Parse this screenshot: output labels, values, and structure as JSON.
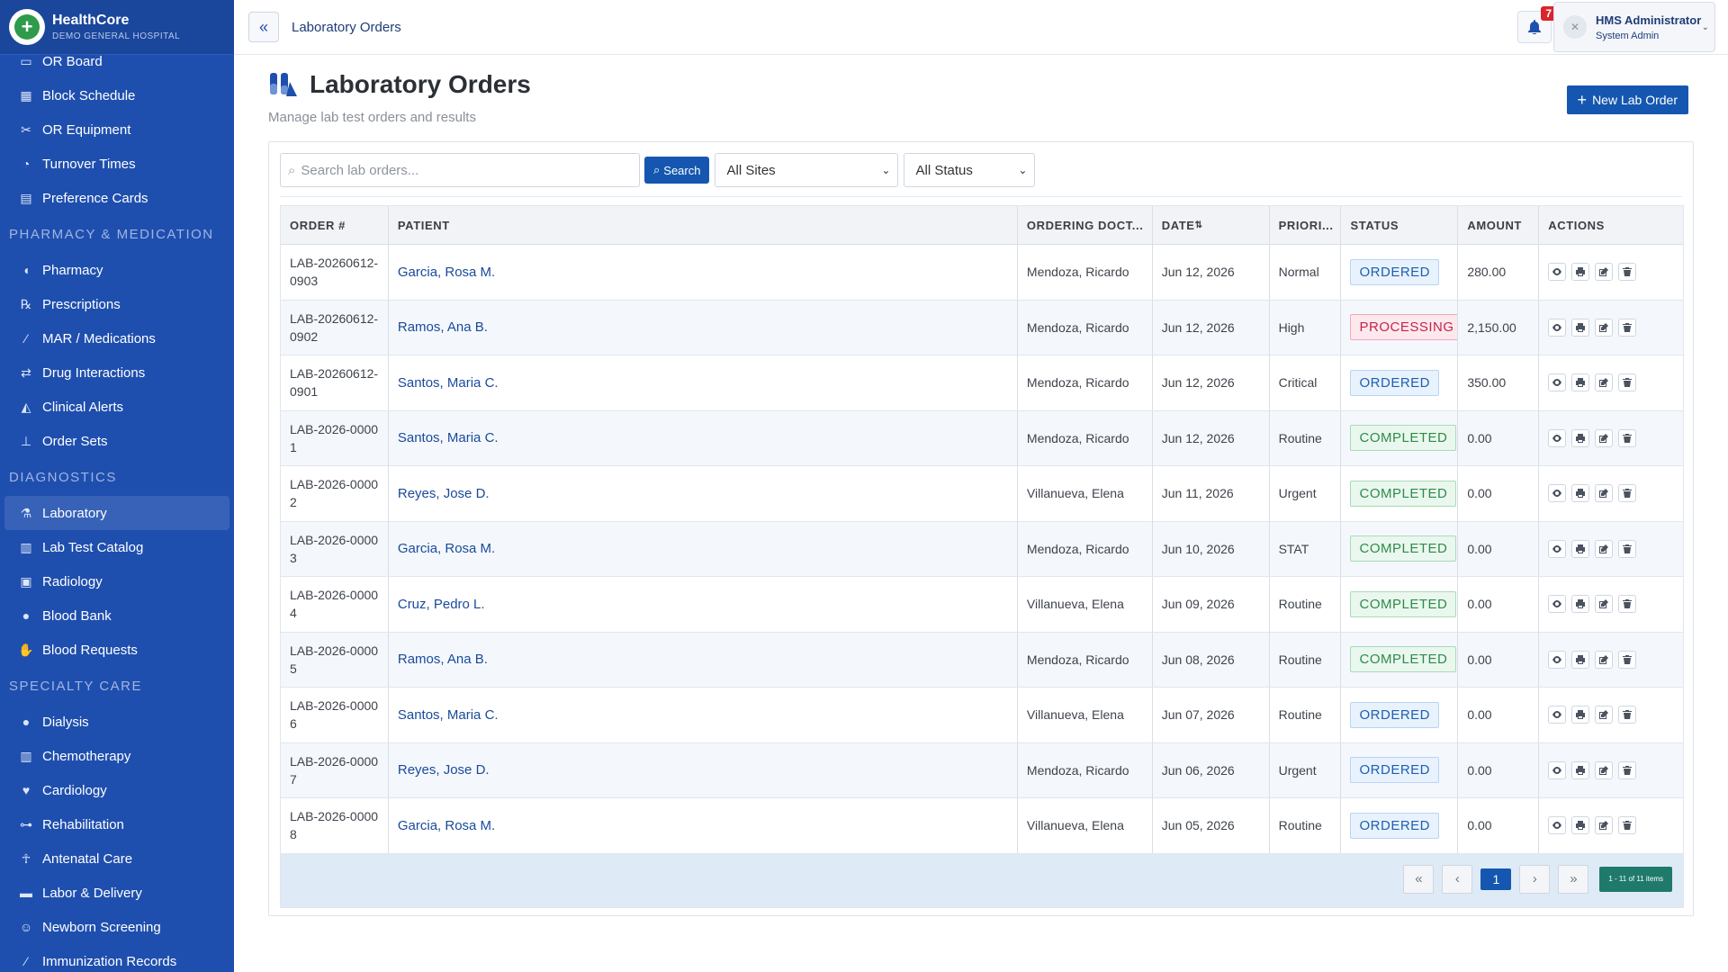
{
  "brand": {
    "name": "HealthCore",
    "sub": "DEMO GENERAL HOSPITAL"
  },
  "sidebar": {
    "items": [
      {
        "label": "OR Board",
        "icon": "monitor-icon"
      },
      {
        "label": "Block Schedule",
        "icon": "calendar-icon"
      },
      {
        "label": "OR Equipment",
        "icon": "tools-icon"
      },
      {
        "label": "Turnover Times",
        "icon": "stopwatch-icon"
      },
      {
        "label": "Preference Cards",
        "icon": "card-list-icon"
      }
    ],
    "section_pharmacy": "PHARMACY & MEDICATION",
    "pharmacy_items": [
      {
        "label": "Pharmacy",
        "icon": "pills-icon"
      },
      {
        "label": "Prescriptions",
        "icon": "prescription-icon"
      },
      {
        "label": "MAR / Medications",
        "icon": "syringe-icon"
      },
      {
        "label": "Drug Interactions",
        "icon": "arrows-exchange-icon"
      },
      {
        "label": "Clinical Alerts",
        "icon": "bell-icon"
      },
      {
        "label": "Order Sets",
        "icon": "sitemap-icon"
      }
    ],
    "section_diagnostics": "DIAGNOSTICS",
    "diagnostics_items": [
      {
        "label": "Laboratory",
        "icon": "flask-icon"
      },
      {
        "label": "Lab Test Catalog",
        "icon": "vials-icon"
      },
      {
        "label": "Radiology",
        "icon": "xray-icon"
      },
      {
        "label": "Blood Bank",
        "icon": "droplet-icon"
      },
      {
        "label": "Blood Requests",
        "icon": "hand-droplet-icon"
      }
    ],
    "section_specialty": "SPECIALTY CARE",
    "specialty_items": [
      {
        "label": "Dialysis",
        "icon": "droplet-icon"
      },
      {
        "label": "Chemotherapy",
        "icon": "vials-icon"
      },
      {
        "label": "Cardiology",
        "icon": "heart-pulse-icon"
      },
      {
        "label": "Rehabilitation",
        "icon": "dumbbell-icon"
      },
      {
        "label": "Antenatal Care",
        "icon": "person-icon"
      },
      {
        "label": "Labor & Delivery",
        "icon": "bed-icon"
      },
      {
        "label": "Newborn Screening",
        "icon": "baby-icon"
      },
      {
        "label": "Immunization Records",
        "icon": "syringe-icon"
      }
    ]
  },
  "topbar": {
    "breadcrumb": "Laboratory Orders",
    "notification_count": "7",
    "user_name": "HMS Administrator",
    "user_role": "System Admin"
  },
  "page": {
    "title": "Laboratory Orders",
    "subtitle": "Manage lab test orders and results",
    "new_button": "New Lab Order"
  },
  "filters": {
    "search_placeholder": "Search lab orders...",
    "search_button": "Search",
    "site_select": "All Sites",
    "status_select": "All Status"
  },
  "table": {
    "columns": [
      "ORDER #",
      "PATIENT",
      "ORDERING DOCT...",
      "DATE",
      "PRIORI...",
      "STATUS",
      "AMOUNT",
      "ACTIONS"
    ],
    "rows": [
      {
        "order": "LAB-20260612-0903",
        "patient": "Garcia, Rosa M.",
        "doctor": "Mendoza, Ricardo",
        "date": "Jun 12, 2026",
        "priority": "Normal",
        "status": "ORDERED",
        "amount": "280.00"
      },
      {
        "order": "LAB-20260612-0902",
        "patient": "Ramos, Ana B.",
        "doctor": "Mendoza, Ricardo",
        "date": "Jun 12, 2026",
        "priority": "High",
        "status": "PROCESSING",
        "amount": "2,150.00"
      },
      {
        "order": "LAB-20260612-0901",
        "patient": "Santos, Maria C.",
        "doctor": "Mendoza, Ricardo",
        "date": "Jun 12, 2026",
        "priority": "Critical",
        "status": "ORDERED",
        "amount": "350.00"
      },
      {
        "order": "LAB-2026-00001",
        "patient": "Santos, Maria C.",
        "doctor": "Mendoza, Ricardo",
        "date": "Jun 12, 2026",
        "priority": "Routine",
        "status": "COMPLETED",
        "amount": "0.00"
      },
      {
        "order": "LAB-2026-00002",
        "patient": "Reyes, Jose D.",
        "doctor": "Villanueva, Elena",
        "date": "Jun 11, 2026",
        "priority": "Urgent",
        "status": "COMPLETED",
        "amount": "0.00"
      },
      {
        "order": "LAB-2026-00003",
        "patient": "Garcia, Rosa M.",
        "doctor": "Mendoza, Ricardo",
        "date": "Jun 10, 2026",
        "priority": "STAT",
        "status": "COMPLETED",
        "amount": "0.00"
      },
      {
        "order": "LAB-2026-00004",
        "patient": "Cruz, Pedro L.",
        "doctor": "Villanueva, Elena",
        "date": "Jun 09, 2026",
        "priority": "Routine",
        "status": "COMPLETED",
        "amount": "0.00"
      },
      {
        "order": "LAB-2026-00005",
        "patient": "Ramos, Ana B.",
        "doctor": "Mendoza, Ricardo",
        "date": "Jun 08, 2026",
        "priority": "Routine",
        "status": "COMPLETED",
        "amount": "0.00"
      },
      {
        "order": "LAB-2026-00006",
        "patient": "Santos, Maria C.",
        "doctor": "Villanueva, Elena",
        "date": "Jun 07, 2026",
        "priority": "Routine",
        "status": "ORDERED",
        "amount": "0.00"
      },
      {
        "order": "LAB-2026-00007",
        "patient": "Reyes, Jose D.",
        "doctor": "Mendoza, Ricardo",
        "date": "Jun 06, 2026",
        "priority": "Urgent",
        "status": "ORDERED",
        "amount": "0.00"
      },
      {
        "order": "LAB-2026-00008",
        "patient": "Garcia, Rosa M.",
        "doctor": "Villanueva, Elena",
        "date": "Jun 05, 2026",
        "priority": "Routine",
        "status": "ORDERED",
        "amount": "0.00"
      }
    ]
  },
  "pager": {
    "current_page": "1",
    "info": "1 - 11 of 11 items",
    "first": "«",
    "prev": "‹",
    "next": "›",
    "last": "»"
  },
  "colors": {
    "sidebar": "#1f4fae",
    "primary": "#1557b0",
    "ordered": "#1f5fb0",
    "processing": "#c4254a",
    "completed": "#2e8b4a"
  }
}
